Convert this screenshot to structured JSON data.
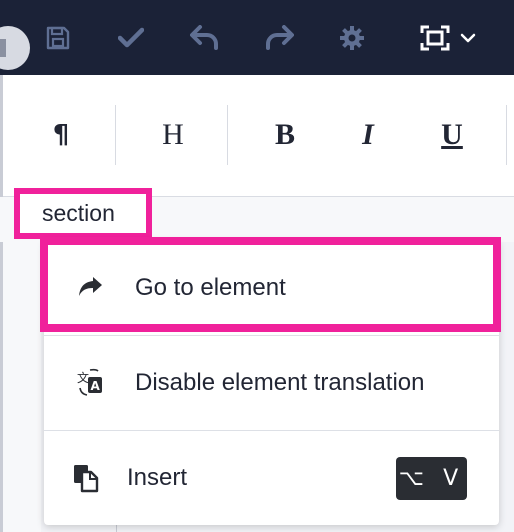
{
  "toolbar": {
    "buttons": [
      {
        "name": "save-icon",
        "label": "Save"
      },
      {
        "name": "check-icon",
        "label": "Accept"
      },
      {
        "name": "undo-icon",
        "label": "Undo"
      },
      {
        "name": "redo-icon",
        "label": "Redo"
      },
      {
        "name": "gear-icon",
        "label": "Settings"
      },
      {
        "name": "fullscreen-icon",
        "label": "Full screen"
      }
    ],
    "colors": {
      "background": "#1b2237",
      "icon": "#5f6f93",
      "icon_active": "#ffffff"
    }
  },
  "format_bar": {
    "paragraph": "¶",
    "heading": "H",
    "bold": "B",
    "italic": "I",
    "underline": "U"
  },
  "breadcrumb": {
    "element": "section"
  },
  "context_menu": {
    "items": [
      {
        "icon": "redo-arrow-icon",
        "label": "Go to element"
      },
      {
        "icon": "translate-icon",
        "label": "Disable element translation"
      },
      {
        "icon": "insert-icon",
        "label": "Insert",
        "shortcut": "⌥ V"
      }
    ]
  },
  "colors": {
    "highlight": "#f0219b"
  }
}
